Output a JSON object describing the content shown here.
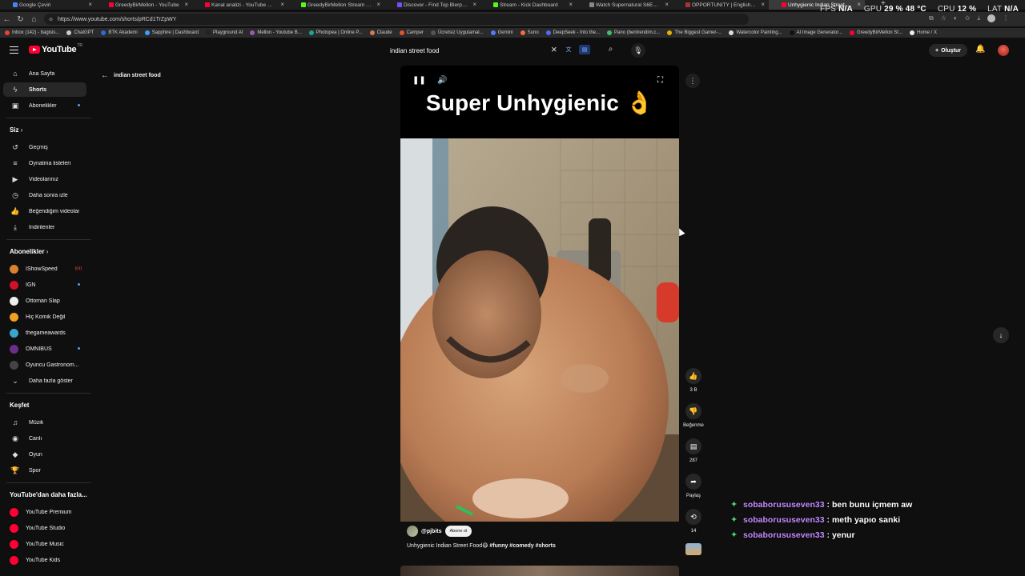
{
  "browser": {
    "tabs": [
      {
        "title": "Google Çeviri",
        "color": "#4285f4"
      },
      {
        "title": "GreedyBirMellon - YouTube",
        "color": "#ff0033"
      },
      {
        "title": "Kanal analizi - YouTube Studio",
        "color": "#ff0033"
      },
      {
        "title": "GreedyBirMellon Stream - Watch",
        "color": "#53fc18"
      },
      {
        "title": "Discover - Find Top Blerps, Stream",
        "color": "#7a4cff"
      },
      {
        "title": "Stream - Kick Dashboard",
        "color": "#53fc18"
      },
      {
        "title": "Watch Supernatural S6E14 online",
        "color": "#888888"
      },
      {
        "title": "OPPORTUNITY | English meaning",
        "color": "#aa3333"
      },
      {
        "title": "Unhygienic Indian Street Fo...",
        "color": "#ff0033",
        "active": true
      }
    ],
    "new_tab": "+",
    "stats": {
      "fps_label": "FPS",
      "fps_value": "N/A",
      "gpu_label": "GPU",
      "gpu_value": "29 % 48 °C",
      "cpu_label": "CPU",
      "cpu_value": "12 %",
      "lat_label": "LAT",
      "lat_value": "N/A"
    },
    "url": "https://www.youtube.com/shorts/pRCd1TrZpWY",
    "bookmarks": [
      {
        "label": "Inbox (142) - bagisis...",
        "color": "#ea4335"
      },
      {
        "label": "ChatGPT",
        "color": "#cccccc"
      },
      {
        "label": "BTK Akademi",
        "color": "#2b6cd8"
      },
      {
        "label": "Sapphire | Dashboard",
        "color": "#3aa0ff"
      },
      {
        "label": "Playground AI",
        "color": "#222222"
      },
      {
        "label": "Mellon - Youtube B...",
        "color": "#9b59b6"
      },
      {
        "label": "Photopea | Online P...",
        "color": "#18a497"
      },
      {
        "label": "Claude",
        "color": "#d97757"
      },
      {
        "label": "Camper",
        "color": "#e8502f"
      },
      {
        "label": "Ücretsiz Uygulamal...",
        "color": "#555555"
      },
      {
        "label": "Gemini",
        "color": "#4f7cff"
      },
      {
        "label": "Suno",
        "color": "#ff6a3d"
      },
      {
        "label": "DeepSeek - Into the...",
        "color": "#4d6bfe"
      },
      {
        "label": "Pano (bentrendim.c...",
        "color": "#3fbf6a"
      },
      {
        "label": "The Biggest Gamer-...",
        "color": "#e5b000"
      },
      {
        "label": "Watercolor Painting...",
        "color": "#dddddd"
      },
      {
        "label": "AI Image Generator...",
        "color": "#111111"
      },
      {
        "label": "GreedyBirMellon St...",
        "color": "#ff0033"
      },
      {
        "label": "Home / X",
        "color": "#eeeeee"
      }
    ]
  },
  "header": {
    "logo_text": "YouTube",
    "logo_region": "TR",
    "search_query": "indian street food",
    "create_label": "Oluştur"
  },
  "sidebar": {
    "main": [
      {
        "label": "Ana Sayfa",
        "icon": "⌂"
      },
      {
        "label": "Shorts",
        "icon": "ϟ",
        "active": true
      },
      {
        "label": "Abonelikler",
        "icon": "▣",
        "dot": true
      }
    ],
    "you_heading": "Siz",
    "you": [
      {
        "label": "Geçmiş",
        "icon": "↺"
      },
      {
        "label": "Oynatma listeleri",
        "icon": "≡"
      },
      {
        "label": "Videolarınız",
        "icon": "▶"
      },
      {
        "label": "Daha sonra izle",
        "icon": "◷"
      },
      {
        "label": "Beğendiğim videolar",
        "icon": "👍"
      },
      {
        "label": "İndirilenler",
        "icon": "⤓"
      }
    ],
    "subs_heading": "Abonelikler",
    "subs": [
      {
        "label": "IShowSpeed",
        "color": "#d9822b",
        "live": true
      },
      {
        "label": "IGN",
        "color": "#d1102b",
        "dot": true
      },
      {
        "label": "Ottoman Slap",
        "color": "#eeeeee"
      },
      {
        "label": "Hiç Komik Değil",
        "color": "#f0a020"
      },
      {
        "label": "thegameawards",
        "color": "#3aa6c9"
      },
      {
        "label": "OMNIBUS",
        "color": "#6a2f8a",
        "dot": true
      },
      {
        "label": "Oyuncu Gastronom...",
        "color": "#444444"
      }
    ],
    "show_more": "Daha fazla göster",
    "explore_heading": "Keşfet",
    "explore": [
      {
        "label": "Müzik",
        "icon": "♫"
      },
      {
        "label": "Canlı",
        "icon": "◉"
      },
      {
        "label": "Oyun",
        "icon": "◆"
      },
      {
        "label": "Spor",
        "icon": "🏆"
      }
    ],
    "more_heading": "YouTube'dan daha fazla...",
    "more": [
      {
        "label": "YouTube Premium",
        "color": "#ff0033"
      },
      {
        "label": "YouTube Studio",
        "color": "#ff0033"
      },
      {
        "label": "YouTube Music",
        "color": "#ff0033"
      },
      {
        "label": "YouTube Kids",
        "color": "#ff0033"
      }
    ]
  },
  "back_link": "indian street food",
  "player": {
    "caption": "Super Unhygienic 👌",
    "channel_handle": "@pjbits",
    "subscribe_label": "Abone ol",
    "title_text": "Unhygienic Indian Street Food😷 ",
    "hashtags": "#funny #comedy #shorts"
  },
  "actions": {
    "like_count": "3 B",
    "dislike_label": "Beğenme",
    "comment_count": "287",
    "share_label": "Paylaş",
    "remix_count": "14"
  },
  "chat": [
    {
      "user": "sobaborususeven33",
      "message": ": ben bunu içmem aw"
    },
    {
      "user": "sobaborususeven33",
      "message": ": meth yapıo sanki"
    },
    {
      "user": "sobaborususeven33",
      "message": ": yenur"
    }
  ]
}
